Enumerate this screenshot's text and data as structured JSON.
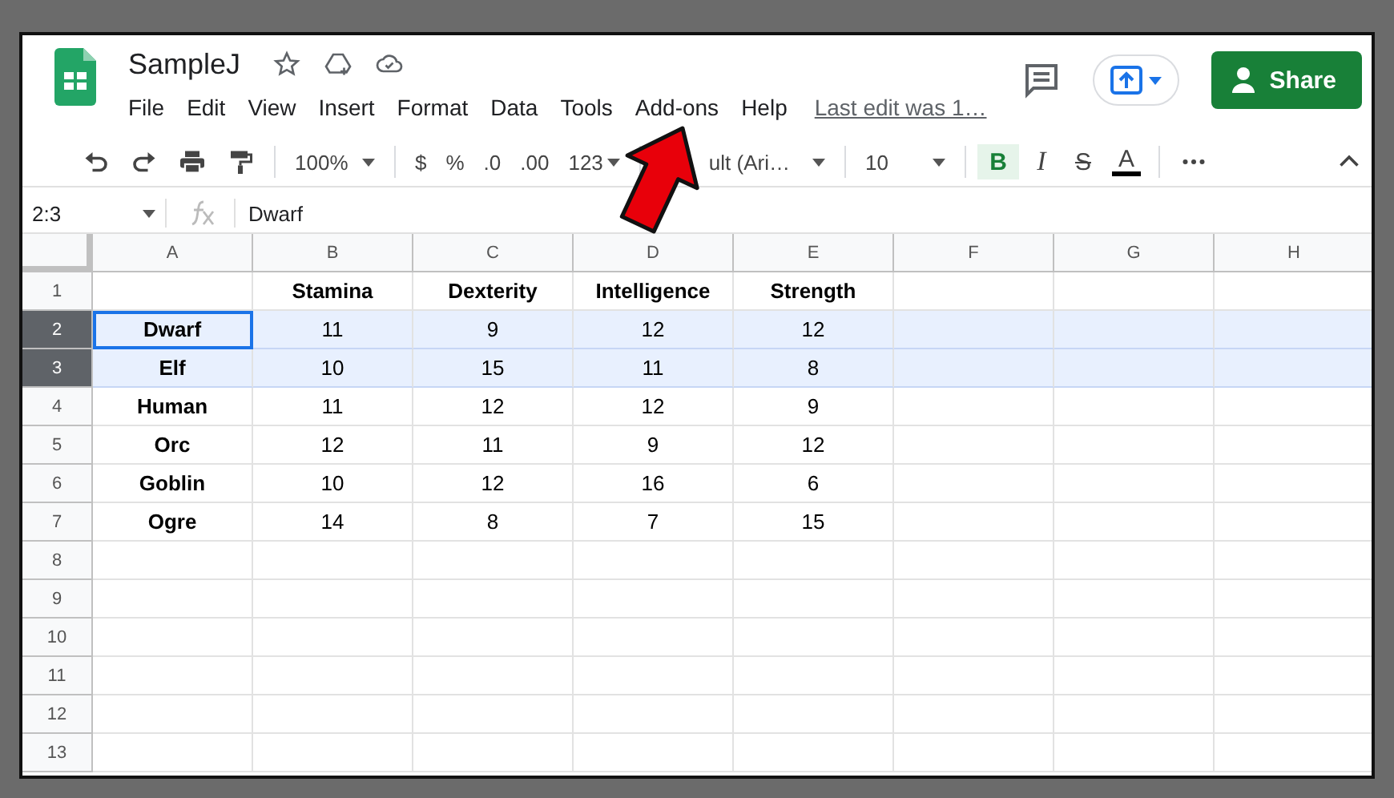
{
  "document": {
    "title": "SampleJ",
    "menu": [
      "File",
      "Edit",
      "View",
      "Insert",
      "Format",
      "Data",
      "Tools",
      "Add-ons",
      "Help"
    ],
    "last_edit": "Last edit was 1…"
  },
  "share_button": "Share",
  "toolbar": {
    "zoom": "100%",
    "currency": "$",
    "percent": "%",
    "decrease_decimals": ".0",
    "increase_decimals": ".00",
    "number_format": "123",
    "font": "ult (Ari…",
    "font_size": "10",
    "bold": "B",
    "bold_on": true,
    "italic": "I",
    "strikethrough": "S",
    "text_color": "A"
  },
  "formula_bar": {
    "cell_ref": "2:3",
    "value": "Dwarf"
  },
  "sheet": {
    "columns": [
      "A",
      "B",
      "C",
      "D",
      "E",
      "F",
      "G",
      "H"
    ],
    "rows": [
      {
        "number": "1",
        "selected": false,
        "cells": [
          null,
          "Stamina",
          "Dexterity",
          "Intelligence",
          "Strength"
        ]
      },
      {
        "number": "2",
        "selected": true,
        "active": true,
        "cells": [
          "Dwarf",
          "11",
          "9",
          "12",
          "12"
        ]
      },
      {
        "number": "3",
        "selected": true,
        "active": false,
        "cells": [
          "Elf",
          "10",
          "15",
          "11",
          "8"
        ]
      },
      {
        "number": "4",
        "selected": false,
        "cells": [
          "Human",
          "11",
          "12",
          "12",
          "9"
        ]
      },
      {
        "number": "5",
        "selected": false,
        "cells": [
          "Orc",
          "12",
          "11",
          "9",
          "12"
        ]
      },
      {
        "number": "6",
        "selected": false,
        "cells": [
          "Goblin",
          "10",
          "12",
          "16",
          "6"
        ]
      },
      {
        "number": "7",
        "selected": false,
        "cells": [
          "Ogre",
          "14",
          "8",
          "7",
          "15"
        ]
      },
      {
        "number": "8",
        "selected": false
      },
      {
        "number": "9",
        "selected": false
      },
      {
        "number": "10",
        "selected": false
      },
      {
        "number": "11",
        "selected": false
      },
      {
        "number": "12",
        "selected": false
      },
      {
        "number": "13",
        "selected": false
      }
    ]
  }
}
